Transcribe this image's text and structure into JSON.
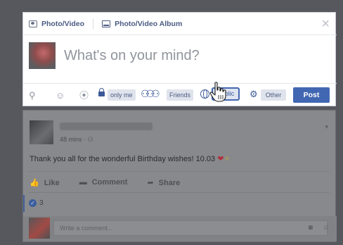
{
  "composer": {
    "tabs": [
      {
        "label": "Photo/Video",
        "icon": "photo-video-icon"
      },
      {
        "label": "Photo/Video Album",
        "icon": "photo-album-icon"
      }
    ],
    "close_icon": "close-icon",
    "placeholder": "What's on your mind?",
    "toolbar": {
      "icons": [
        "tag-friends-icon",
        "feeling-icon",
        "location-icon"
      ],
      "audience_options": [
        "only me",
        "Friends",
        "Public",
        "Other"
      ],
      "selected_audience": "Public",
      "post_label": "Post"
    },
    "colors": {
      "accent": "#4267b2",
      "audience_bg": "#dfe3ec"
    }
  },
  "feed_post": {
    "meta": "48 mins",
    "text": "Thank you all for the wonderful Birthday wishes! 10.03",
    "emoji": [
      "heart",
      "sparkle"
    ],
    "actions": [
      {
        "label": "Like",
        "icon": "like-icon"
      },
      {
        "label": "Comment",
        "icon": "comment-icon"
      },
      {
        "label": "Share",
        "icon": "share-icon"
      }
    ],
    "reaction_count": "3",
    "comment_placeholder": "Write a comment..."
  }
}
